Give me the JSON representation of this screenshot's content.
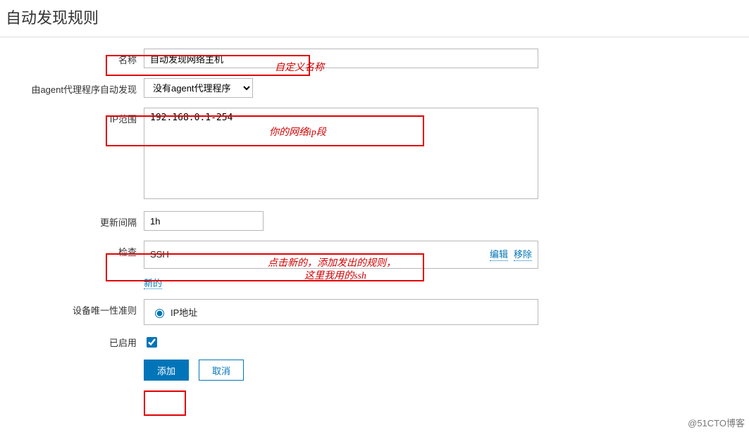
{
  "title": "自动发现规则",
  "form": {
    "name_label": "名称",
    "name_value": "自动发现网络主机",
    "agent_label": "由agent代理程序自动发现",
    "agent_value": "没有agent代理程序",
    "ip_label": "IP范围",
    "ip_value": "192.168.0.1-254",
    "interval_label": "更新间隔",
    "interval_value": "1h",
    "check_label": "检查",
    "check_value": "SSH",
    "check_edit": "编辑",
    "check_remove": "移除",
    "check_new": "新的",
    "unique_label": "设备唯一性准则",
    "unique_option": "IP地址",
    "enabled_label": "已启用",
    "submit": "添加",
    "cancel": "取消"
  },
  "annotations": {
    "a1": "自定义名称",
    "a2": "你的网络ip段",
    "a3_line1": "点击新的，添加发出的规则，",
    "a3_line2": "这里我用的ssh"
  },
  "watermark": "@51CTO博客"
}
